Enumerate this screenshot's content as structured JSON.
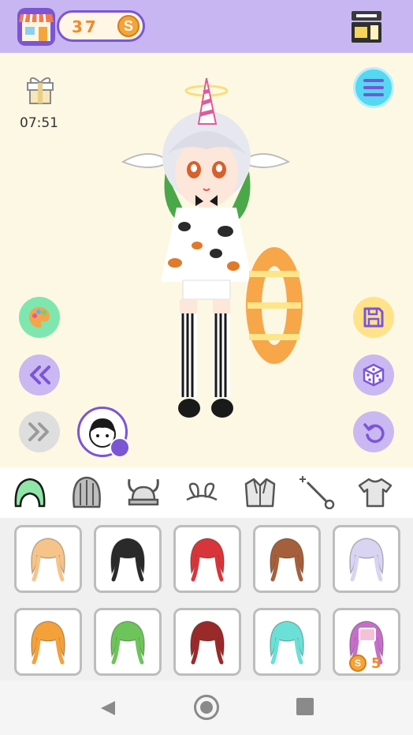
{
  "header": {
    "coins": "37",
    "coin_symbol": "S"
  },
  "stage": {
    "gift_timer": "07:51"
  },
  "categories": [
    {
      "name": "hair-front",
      "icon": "hair-icon",
      "selected": true
    },
    {
      "name": "hair-back",
      "icon": "hair-back-icon",
      "selected": false
    },
    {
      "name": "headwear",
      "icon": "horned-helmet-icon",
      "selected": false
    },
    {
      "name": "ears",
      "icon": "bunny-ears-icon",
      "selected": false
    },
    {
      "name": "jacket",
      "icon": "jacket-icon",
      "selected": false
    },
    {
      "name": "wand",
      "icon": "magic-wand-icon",
      "selected": false
    },
    {
      "name": "top",
      "icon": "tshirt-icon",
      "selected": false
    }
  ],
  "items": [
    {
      "color": "#f6c48a",
      "locked": false
    },
    {
      "color": "#2a2a2a",
      "locked": false
    },
    {
      "color": "#d8353a",
      "locked": false
    },
    {
      "color": "#a5603b",
      "locked": false
    },
    {
      "color": "#d9d4f2",
      "locked": false
    },
    {
      "color": "#f4a13a",
      "locked": false
    },
    {
      "color": "#6dc45a",
      "locked": false
    },
    {
      "color": "#9a2a2a",
      "locked": false
    },
    {
      "color": "#6be0d6",
      "locked": false
    },
    {
      "color": "#c56fc8",
      "locked": true,
      "price_symbol": "S",
      "price": "5"
    }
  ],
  "colors": {
    "accent": "#7b55d6",
    "topbar": "#c8b6f2",
    "stage_bg": "#fdf8e4"
  }
}
